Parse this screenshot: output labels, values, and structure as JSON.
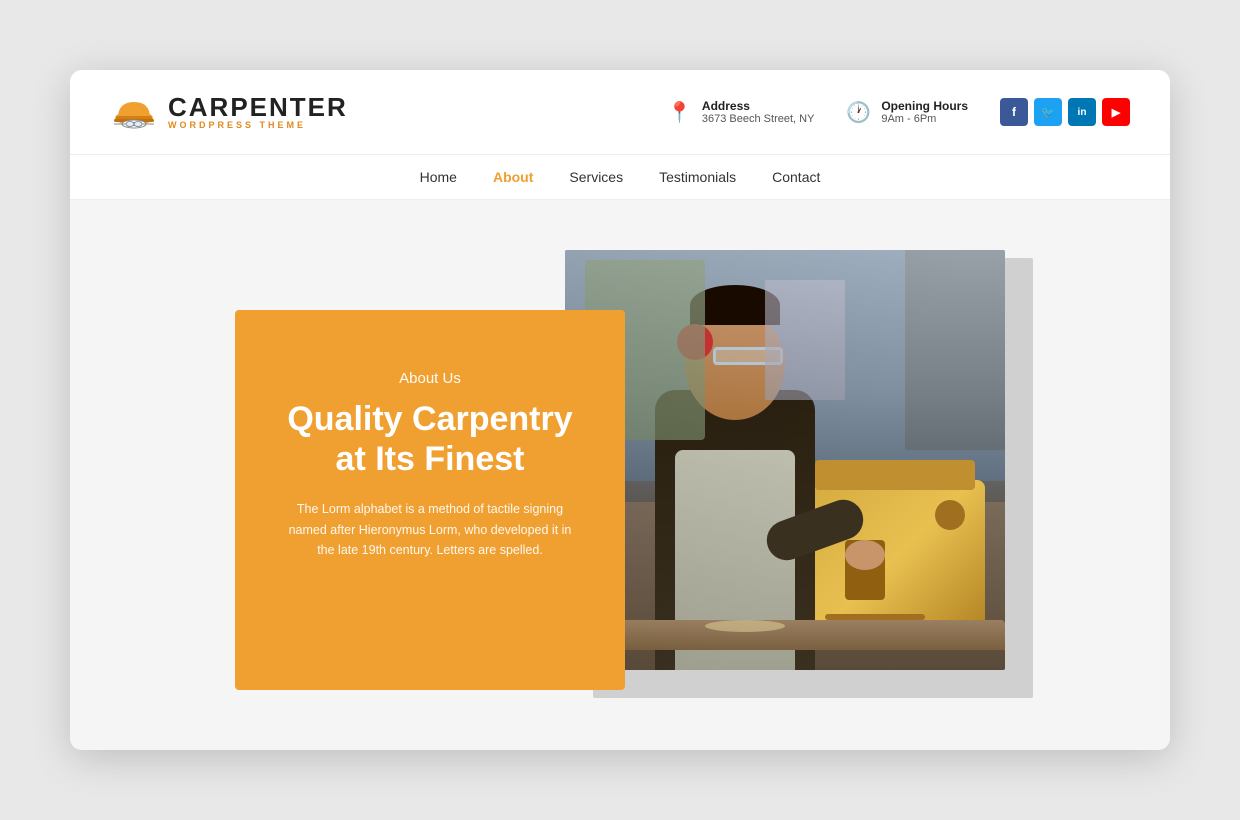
{
  "browser": {
    "bg_color": "#e0e0e0"
  },
  "header": {
    "logo_title": "CARPENTER",
    "logo_sub": "WORDPRESS THEME",
    "address_label": "Address",
    "address_value": "3673 Beech Street, NY",
    "hours_label": "Opening Hours",
    "hours_value": "9Am - 6Pm"
  },
  "social": [
    {
      "name": "Facebook",
      "short": "f",
      "class": "social-fb"
    },
    {
      "name": "Twitter",
      "short": "t",
      "class": "social-tw"
    },
    {
      "name": "LinkedIn",
      "short": "in",
      "class": "social-li"
    },
    {
      "name": "YouTube",
      "short": "▶",
      "class": "social-yt"
    }
  ],
  "nav": {
    "items": [
      {
        "label": "Home",
        "active": false
      },
      {
        "label": "About",
        "active": true
      },
      {
        "label": "Services",
        "active": false
      },
      {
        "label": "Testimonials",
        "active": false
      },
      {
        "label": "Contact",
        "active": false
      }
    ]
  },
  "about": {
    "label": "About Us",
    "heading": "Quality Carpentry at Its Finest",
    "body": "The Lorm alphabet is a method of tactile signing named after Hieronymus Lorm, who developed it in the late 19th century. Letters are spelled."
  },
  "colors": {
    "orange": "#f0a030",
    "accent": "#e08a20",
    "dark": "#222222"
  }
}
